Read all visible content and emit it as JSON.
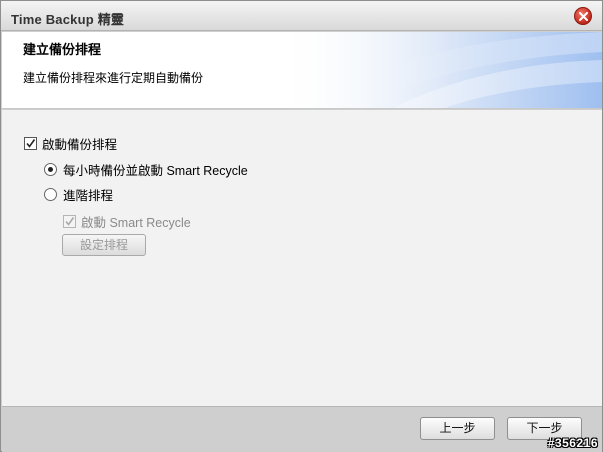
{
  "window": {
    "title": "Time Backup 精靈"
  },
  "header": {
    "title": "建立備份排程",
    "description": "建立備份排程來進行定期自動備份"
  },
  "options": {
    "enable_schedule": {
      "label": "啟動備份排程",
      "checked": true
    },
    "hourly_radio": {
      "label": "每小時備份並啟動 Smart Recycle",
      "selected": true
    },
    "advanced_radio": {
      "label": "進階排程",
      "selected": false
    },
    "smart_recycle": {
      "label": "啟動 Smart Recycle",
      "checked": true,
      "disabled": true
    },
    "set_schedule_button": "設定排程"
  },
  "footer": {
    "back_label": "上一步",
    "next_label": "下一步"
  },
  "watermark": "#356216",
  "colors": {
    "close_button": "#c0281a",
    "header_accent": "#a9c6f0"
  }
}
